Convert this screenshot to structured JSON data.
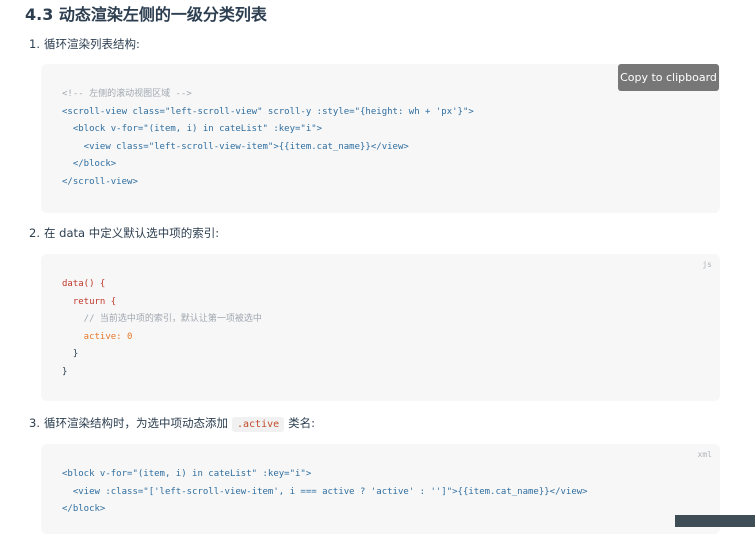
{
  "section_title": "4.3 动态渲染左侧的一级分类列表",
  "steps": [
    {
      "num": "1.",
      "text": "循环渲染列表结构:"
    },
    {
      "num": "2.",
      "text": "在 data 中定义默认选中项的索引:"
    },
    {
      "num": "3.",
      "text_before": "循环渲染结构时，为选中项动态添加",
      "code": ".active",
      "text_after": "类名:"
    }
  ],
  "copy_button_label": "Copy to clipboard",
  "code_blocks": [
    {
      "lines": [
        "<!-- 左侧的滚动视图区域 -->",
        "<scroll-view class=\"left-scroll-view\" scroll-y :style=\"{height: wh + 'px'}\">",
        "  <block v-for=\"(item, i) in cateList\" :key=\"i\">",
        "    <view class=\"left-scroll-view-item\">{{item.cat_name}}</view>",
        "  </block>",
        "</scroll-view>"
      ]
    },
    {
      "lang": "js",
      "lines": [
        "data() {",
        "  return {",
        "    // 当前选中项的索引，默认让第一项被选中",
        "    active: 0",
        "  }",
        "}"
      ]
    },
    {
      "lang": "xml",
      "lines": [
        "<block v-for=\"(item, i) in cateList\" :key=\"i\">",
        "  <view :class=\"['left-scroll-view-item', i === active ? 'active' : '']\">{{item.cat_name}}</view>",
        "</block>"
      ]
    }
  ],
  "colors": {
    "code_bg": "#f7f7f7",
    "tag": "#2f6ea0",
    "string": "#3f9a6a",
    "comment": "#a0a8b0",
    "keyword": "#c0392b",
    "number": "#e6782a",
    "copy_button_bg": "#777777"
  }
}
